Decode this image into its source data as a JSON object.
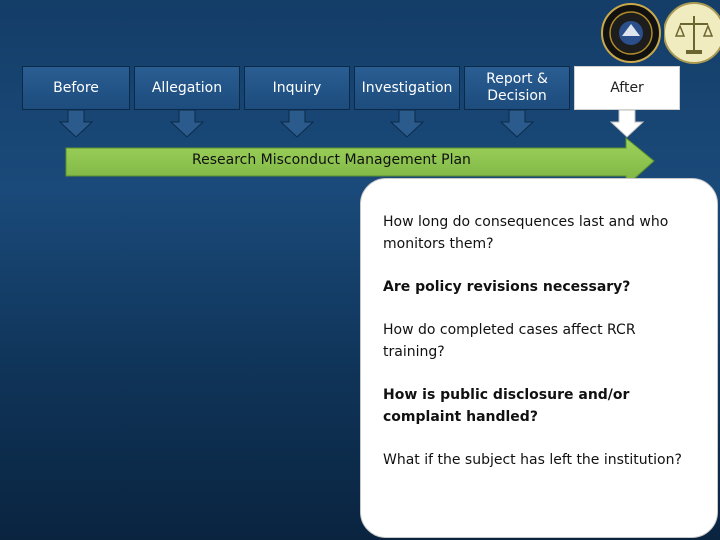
{
  "stages": [
    {
      "label": "Before",
      "active": false
    },
    {
      "label": "Allegation",
      "active": false
    },
    {
      "label": "Inquiry",
      "active": false
    },
    {
      "label": "Investigation",
      "active": false
    },
    {
      "label": "Report &\nDecision",
      "active": false
    },
    {
      "label": "After",
      "active": true
    }
  ],
  "band": {
    "label": "Research Misconduct Management Plan",
    "color": "#8bc34a"
  },
  "questions": [
    {
      "text": "How long do consequences last and who monitors them?",
      "bold": false
    },
    {
      "text": "Are policy revisions necessary?",
      "bold": true
    },
    {
      "text": "How do completed cases affect RCR training?",
      "bold": false
    },
    {
      "text": "How is public disclosure and/or complaint handled?",
      "bold": true
    },
    {
      "text": "What if the subject has left the institution?",
      "bold": false
    }
  ],
  "logos": [
    {
      "icon": "nsf-seal-icon"
    },
    {
      "icon": "justice-scales-seal-icon"
    }
  ]
}
